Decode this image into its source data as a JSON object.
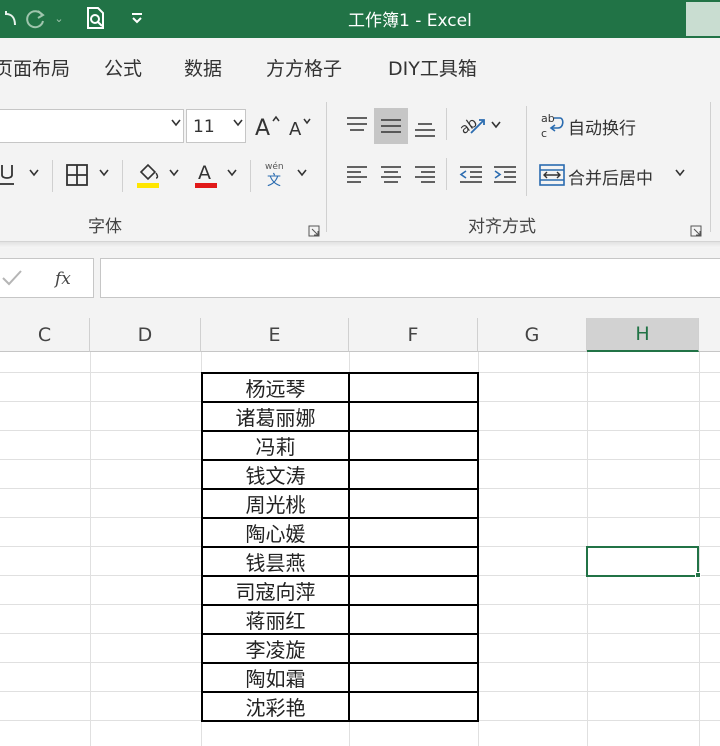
{
  "window": {
    "title": "工作簿1  -  Excel"
  },
  "tabs": [
    "页面布局",
    "公式",
    "数据",
    "方方格子",
    "DIY工具箱"
  ],
  "font_group": {
    "font_name": "",
    "font_size": "11",
    "label": "字体",
    "font_color": "#e11919",
    "fill_color": "#ffe600"
  },
  "align_group": {
    "wrap_label": "自动换行",
    "merge_label": "合并后居中",
    "label": "对齐方式"
  },
  "formula_bar": {
    "value": ""
  },
  "sheet": {
    "columns": [
      "C",
      "D",
      "E",
      "F",
      "G",
      "H"
    ],
    "selected_column": "H",
    "names": [
      "杨远琴",
      "诸葛丽娜",
      "冯莉",
      "钱文涛",
      "周光桃",
      "陶心媛",
      "钱昙燕",
      "司寇向萍",
      "蒋丽红",
      "李凌旋",
      "陶如霜",
      "沈彩艳"
    ]
  },
  "colors": {
    "accent": "#217346"
  }
}
